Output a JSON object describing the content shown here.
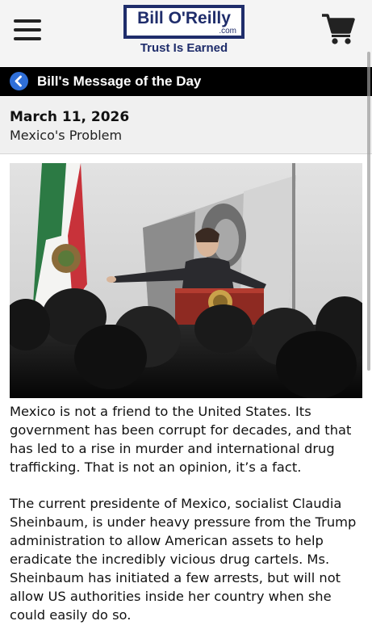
{
  "header": {
    "logo_name": "Bill O'Reilly",
    "logo_domain": ".com",
    "logo_tagline": "Trust Is Earned"
  },
  "section": {
    "title": "Bill's Message of the Day"
  },
  "post": {
    "date": "March 11, 2026",
    "title": "Mexico's Problem",
    "paragraphs": [
      "Mexico is not a friend to the United States. Its government has been corrupt for decades, and that has led to a rise in murder and international drug trafficking. That is not an opinion, it’s a fact.",
      "The current presidente of Mexico, socialist Claudia Sheinbaum, is under heavy pressure from the Trump administration to allow American assets to help eradicate the incredibly vicious drug cartels. Ms. Sheinbaum has initiated a few arrests, but will not allow US authorities inside her country when she could easily do so."
    ]
  },
  "icons": {
    "menu": "hamburger-menu-icon",
    "cart": "shopping-cart-icon",
    "back": "back-chevron-icon"
  },
  "colors": {
    "brand_navy": "#1f2d6b",
    "section_bar": "#000000",
    "back_button": "#2f6fd8"
  }
}
